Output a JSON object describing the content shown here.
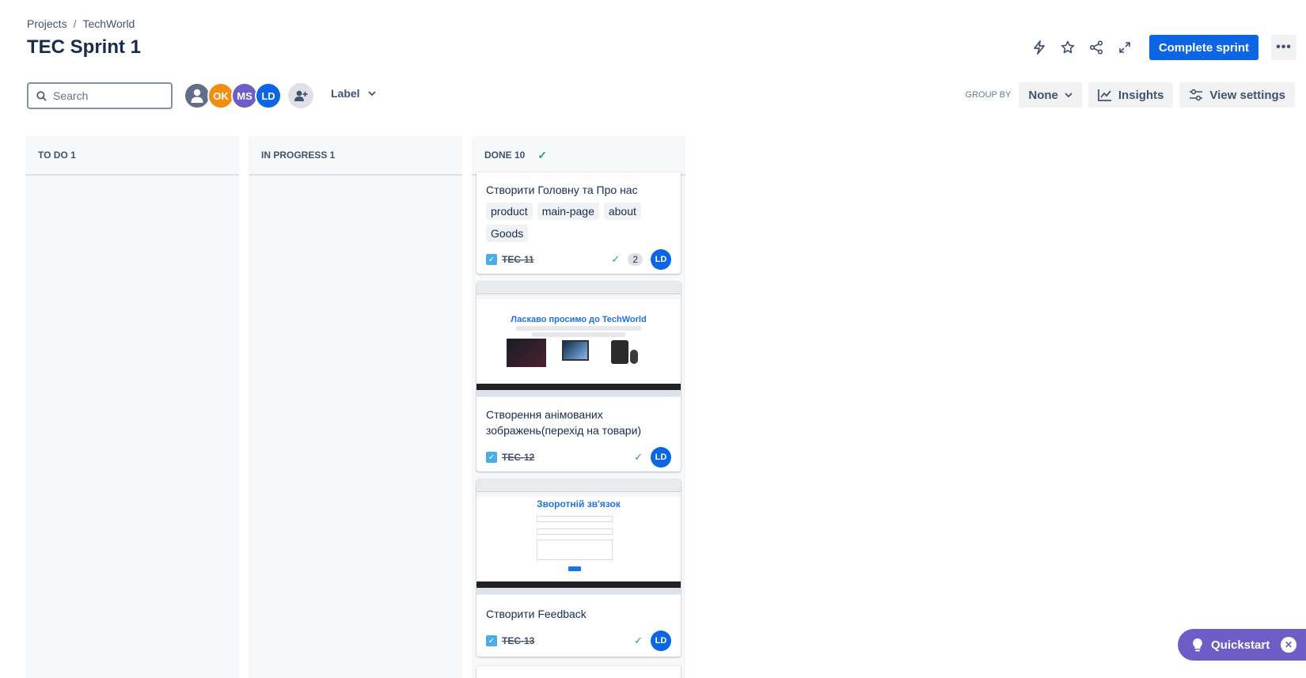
{
  "breadcrumb": {
    "root": "Projects",
    "separator": "/",
    "project": "TechWorld"
  },
  "page_title": "TEC Sprint 1",
  "header": {
    "complete_label": "Complete sprint"
  },
  "search": {
    "placeholder": "Search"
  },
  "avatars": [
    {
      "initials": "",
      "color": "#626f86"
    },
    {
      "initials": "OK",
      "color": "#f18d13"
    },
    {
      "initials": "MS",
      "color": "#6e5dc6"
    },
    {
      "initials": "LD",
      "color": "#0c66e4"
    }
  ],
  "filters": {
    "label": "Label"
  },
  "toolbar": {
    "group_by_label": "GROUP BY",
    "group_by_value": "None",
    "insights_label": "Insights",
    "view_settings_label": "View settings"
  },
  "columns": [
    {
      "title": "TO DO 1"
    },
    {
      "title": "IN PROGRESS 1"
    },
    {
      "title": "DONE 10"
    }
  ],
  "cards": [
    {
      "title": "Створити Головну та Про нас",
      "labels": [
        "product",
        "main-page",
        "about",
        "Goods"
      ],
      "key": "TEC-11",
      "points": "2",
      "assignee": "LD"
    },
    {
      "title": "Створення анімованих зображень(перехід на товари)",
      "key": "TEC-12",
      "assignee": "LD",
      "thumb_heading": "Ласкаво просимо до TechWorld"
    },
    {
      "title": "Створити Feedback",
      "key": "TEC-13",
      "assignee": "LD",
      "thumb_heading": "Зворотній зв'язок"
    }
  ],
  "quickstart": {
    "label": "Quickstart"
  }
}
